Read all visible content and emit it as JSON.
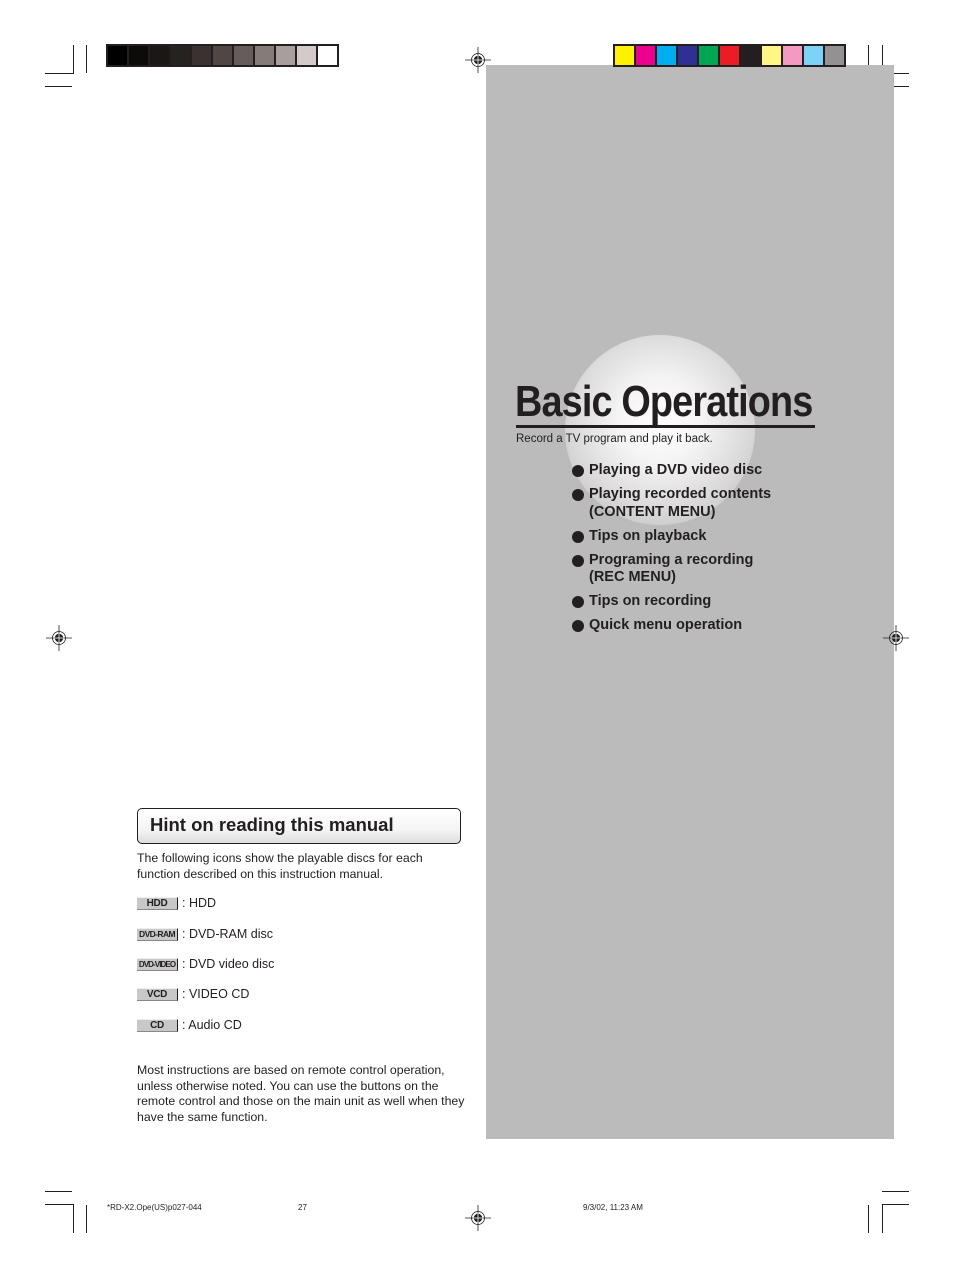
{
  "print_marks": {
    "grayscale_swatches": [
      "#000000",
      "#0d0b0a",
      "#1a1715",
      "#262220",
      "#3a3230",
      "#504644",
      "#665c5a",
      "#857b79",
      "#a89e9c",
      "#d2cbca",
      "#ffffff"
    ],
    "color_swatches": [
      "#fff200",
      "#ec008c",
      "#00aeef",
      "#2e3192",
      "#00a651",
      "#ed1c24",
      "#231f20",
      "#fff685",
      "#f49ac1",
      "#7dd3f7",
      "#939191"
    ]
  },
  "section": {
    "title": "Basic Operations",
    "subtitle": "Record a TV program and play it back.",
    "topics": [
      {
        "line1": "Playing a DVD video disc",
        "line2": ""
      },
      {
        "line1": "Playing recorded contents",
        "line2": "(CONTENT MENU)"
      },
      {
        "line1": "Tips on playback",
        "line2": ""
      },
      {
        "line1": "Programing a recording",
        "line2": "(REC MENU)"
      },
      {
        "line1": "Tips on recording",
        "line2": ""
      },
      {
        "line1": "Quick menu operation",
        "line2": ""
      }
    ]
  },
  "hint": {
    "title": "Hint on reading this manual",
    "intro": "The following icons show the playable discs for each function described on this instruction manual.",
    "discs": [
      {
        "icon_label": "HDD",
        "description": ": HDD"
      },
      {
        "icon_label": "DVD-RAM",
        "description": ": DVD-RAM disc"
      },
      {
        "icon_label": "DVD-VIDEO",
        "description": ": DVD video disc"
      },
      {
        "icon_label": "VCD",
        "description": ": VIDEO CD"
      },
      {
        "icon_label": "CD",
        "description": ": Audio CD"
      }
    ],
    "notes": "Most instructions are based on remote control operation, unless otherwise noted.  You can use the buttons on the remote control and those on the main unit as well when they have the same function."
  },
  "footer": {
    "file": "*RD-X2.Ope(US)p027-044",
    "page": "27",
    "timestamp": "9/3/02, 11:23 AM"
  }
}
